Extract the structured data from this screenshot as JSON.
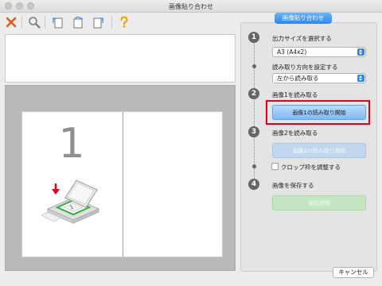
{
  "window": {
    "title": "画像貼り合わせ",
    "right_tab": "画像貼り合わせ"
  },
  "toolbar": {
    "icons": [
      "delete-icon",
      "zoom-icon",
      "rotate-left-icon",
      "rotate-180-icon",
      "rotate-right-icon",
      "help-icon"
    ]
  },
  "preview": {
    "page_number": "1"
  },
  "steps": {
    "step1": {
      "number": "1",
      "label": "出力サイズを選択する",
      "size_value": "A3 (A4x2)",
      "direction_label": "読み取り方向を設定する",
      "direction_value": "左から読み取る"
    },
    "step2": {
      "number": "2",
      "label": "画像1を読み取る",
      "button": "画像1の読み取り開始"
    },
    "step3": {
      "number": "3",
      "label": "画像2を読み取る",
      "button": "画像2の読み取り開始",
      "crop_label": "クロップ枠を調整する",
      "crop_checked": false
    },
    "step4": {
      "number": "4",
      "label": "画像を保存する",
      "button": "保存開始"
    }
  },
  "footer": {
    "cancel": "キャンセル"
  },
  "colors": {
    "accent": "#2c88ee",
    "highlight": "#e2001a",
    "delete": "#e05a1c",
    "help": "#e8a418"
  }
}
